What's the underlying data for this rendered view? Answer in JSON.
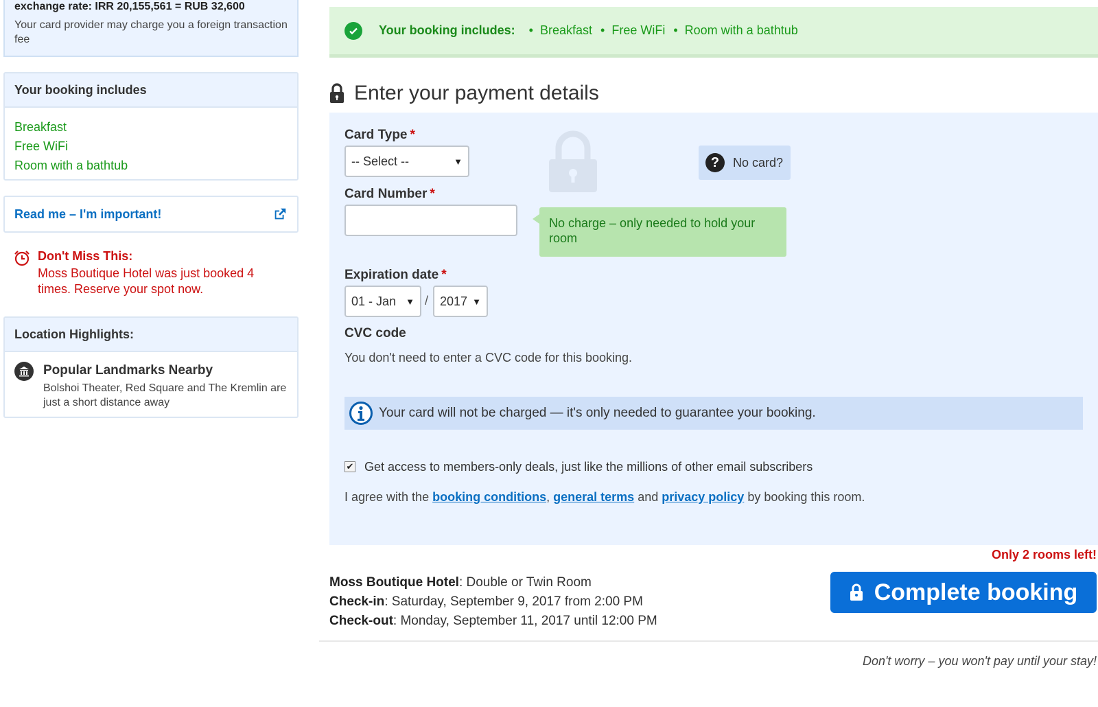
{
  "sidebar": {
    "exchange": {
      "title": "exchange rate: IRR 20,155,561 = RUB 32,600",
      "note": "Your card provider may charge you a foreign transaction fee"
    },
    "includes": {
      "heading": "Your booking includes",
      "items": [
        "Breakfast",
        "Free WiFi",
        "Room with a bathtub"
      ]
    },
    "readme": {
      "label": "Read me – I'm important!"
    },
    "urgency": {
      "title": "Don't Miss This:",
      "text": "Moss Boutique Hotel was just booked 4 times. Reserve your spot now."
    },
    "location": {
      "heading": "Location Highlights:",
      "title": "Popular Landmarks Nearby",
      "text": "Bolshoi Theater, Red Square and The Kremlin are just a short distance away"
    }
  },
  "banner": {
    "title": "Your booking includes:",
    "items": [
      "Breakfast",
      "Free WiFi",
      "Room with a bathtub"
    ]
  },
  "payment": {
    "heading": "Enter your payment details",
    "card_type": {
      "label": "Card Type",
      "required": "*",
      "value": "-- Select --"
    },
    "no_card": {
      "label": "No card?"
    },
    "card_number": {
      "label": "Card Number",
      "required": "*",
      "value": ""
    },
    "tooltip": "No charge – only needed to hold your room",
    "expiration": {
      "label": "Expiration date",
      "required": "*",
      "month": "01 - Jan",
      "separator": "/",
      "year": "2017"
    },
    "cvc": {
      "label": "CVC code",
      "note": "You don't need to enter a CVC code for this booking."
    },
    "info": "Your card will not be charged — it's only needed to guarantee your booking.",
    "opt_in": {
      "checked": true,
      "label": "Get access to members-only deals, just like the millions of other email subscribers"
    },
    "agree": {
      "prefix": "I agree with the",
      "booking_conditions": "booking conditions",
      "comma": ",",
      "general_terms": "general terms",
      "and": "and",
      "privacy_policy": "privacy policy",
      "suffix": "by booking this room."
    }
  },
  "footer": {
    "only_left": "Only 2 rooms left!",
    "hotel_label": "Moss Boutique Hotel",
    "room": ": Double or Twin Room",
    "checkin_label": "Check-in",
    "checkin": ": Saturday, September 9, 2017 from 2:00 PM",
    "checkout_label": "Check-out",
    "checkout": ": Monday, September 11, 2017 until 12:00 PM",
    "button": "Complete booking",
    "reassure": "Don't worry – you won't pay until your stay!"
  },
  "colors": {
    "accent": "#0a6fd8",
    "success": "#1a9a1a",
    "alert": "#cc1111",
    "panel": "#ebf3ff"
  }
}
